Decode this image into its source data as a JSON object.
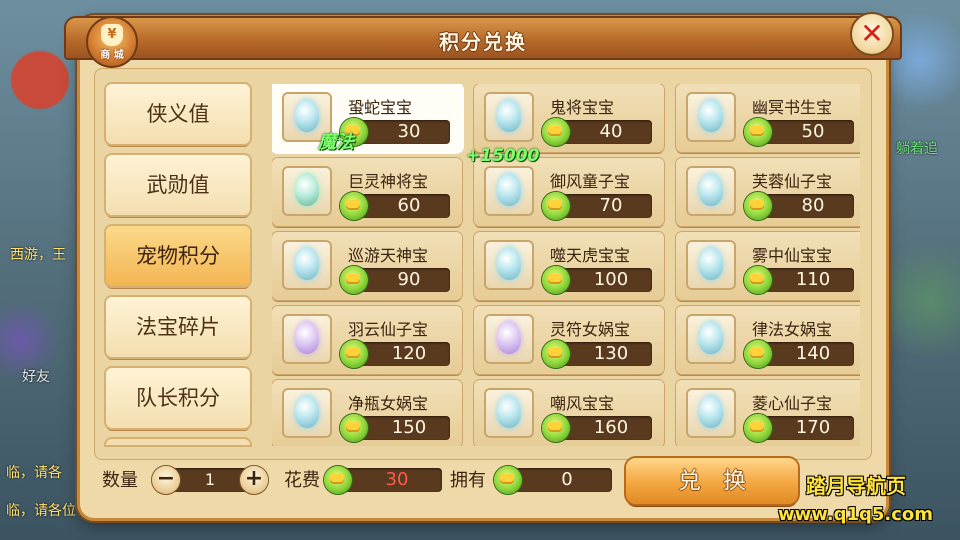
{
  "dialog": {
    "title": "积分兑换",
    "shop_icon_label": "商 城",
    "close_glyph": "✕"
  },
  "sidebar": {
    "items": [
      {
        "label": "侠义值",
        "active": false
      },
      {
        "label": "武勋值",
        "active": false
      },
      {
        "label": "宠物积分",
        "active": true
      },
      {
        "label": "法宝碎片",
        "active": false
      },
      {
        "label": "队长积分",
        "active": false
      }
    ]
  },
  "items": [
    {
      "name": "蛩蛇宝宝",
      "price": "30",
      "egg": "blue",
      "selected": true
    },
    {
      "name": "鬼将宝宝",
      "price": "40",
      "egg": "blue",
      "selected": false
    },
    {
      "name": "幽冥书生宝",
      "price": "50",
      "egg": "blue",
      "selected": false
    },
    {
      "name": "巨灵神将宝",
      "price": "60",
      "egg": "teal",
      "selected": false
    },
    {
      "name": "御风童子宝",
      "price": "70",
      "egg": "blue",
      "selected": false
    },
    {
      "name": "芙蓉仙子宝",
      "price": "80",
      "egg": "blue",
      "selected": false
    },
    {
      "name": "巡游天神宝",
      "price": "90",
      "egg": "blue",
      "selected": false
    },
    {
      "name": "噬天虎宝宝",
      "price": "100",
      "egg": "blue",
      "selected": false
    },
    {
      "name": "雾中仙宝宝",
      "price": "110",
      "egg": "blue",
      "selected": false
    },
    {
      "name": "羽云仙子宝",
      "price": "120",
      "egg": "purple",
      "selected": false
    },
    {
      "name": "灵符女娲宝",
      "price": "130",
      "egg": "purple",
      "selected": false
    },
    {
      "name": "律法女娲宝",
      "price": "140",
      "egg": "blue",
      "selected": false
    },
    {
      "name": "净瓶女娲宝",
      "price": "150",
      "egg": "blue",
      "selected": false
    },
    {
      "name": "嘲风宝宝",
      "price": "160",
      "egg": "blue",
      "selected": false
    },
    {
      "name": "菱心仙子宝",
      "price": "170",
      "egg": "blue",
      "selected": false
    }
  ],
  "floating": {
    "magic": "魔法",
    "amount": "+15000"
  },
  "bottom": {
    "quantity_label": "数量",
    "quantity_value": "1",
    "minus_glyph": "−",
    "plus_glyph": "+",
    "cost_label": "花费",
    "cost_value": "30",
    "cost_color": "#ff5a4a",
    "owned_label": "拥有",
    "owned_value": "0",
    "exchange_label": "兑换"
  },
  "background": {
    "left_texts": [
      "西游，王",
      "好友",
      "临，请各",
      "临，请各位"
    ],
    "right_texts": [
      "躺着追"
    ]
  },
  "watermark": {
    "line1": "踏月导航页",
    "line2": "www.q1q5.com"
  }
}
